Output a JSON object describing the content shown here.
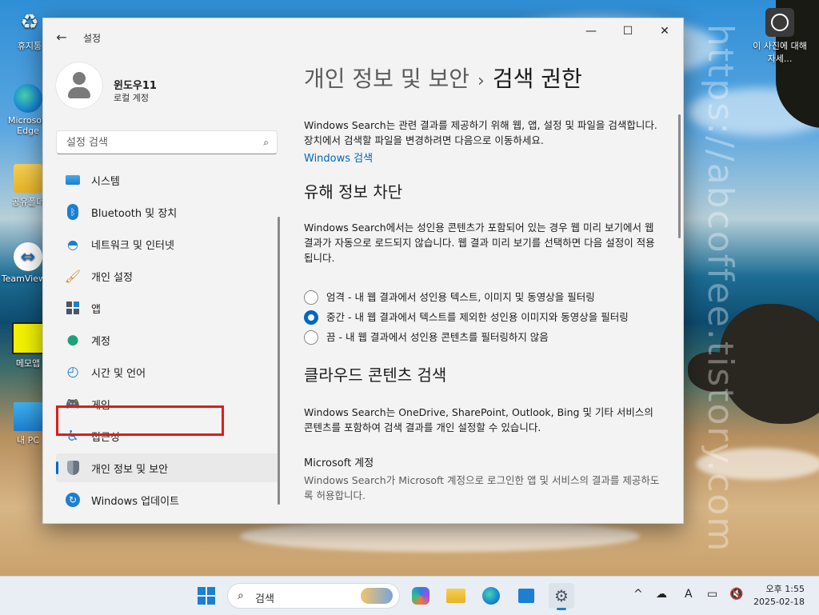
{
  "desktop": {
    "icons": [
      {
        "label": "휴지통",
        "icon": "recycle-bin-icon"
      },
      {
        "label": "Microsoft Edge",
        "icon": "edge-icon"
      },
      {
        "label": "공유폴더",
        "icon": "folder-icon"
      },
      {
        "label": "TeamViewer",
        "icon": "teamviewer-icon"
      },
      {
        "label": "메모앱",
        "icon": "memo-icon"
      },
      {
        "label": "내 PC",
        "icon": "pc-icon"
      }
    ],
    "right_icon_label": "이 사진에 대해 자세...",
    "watermark": "https://abcoffee.tistory.com"
  },
  "window": {
    "title": "설정",
    "controls": {
      "minimize": "—",
      "maximize": "☐",
      "close": "✕"
    },
    "profile": {
      "name": "윈도우11",
      "account_type": "로컬 계정"
    },
    "search": {
      "placeholder": "설정 검색"
    },
    "nav": [
      {
        "label": "시스템",
        "icon": "system-icon"
      },
      {
        "label": "Bluetooth 및 장치",
        "icon": "bluetooth-icon"
      },
      {
        "label": "네트워크 및 인터넷",
        "icon": "network-icon"
      },
      {
        "label": "개인 설정",
        "icon": "brush-icon"
      },
      {
        "label": "앱",
        "icon": "apps-icon"
      },
      {
        "label": "계정",
        "icon": "account-icon"
      },
      {
        "label": "시간 및 언어",
        "icon": "clock-globe-icon"
      },
      {
        "label": "게임",
        "icon": "gamepad-icon"
      },
      {
        "label": "접근성",
        "icon": "accessibility-icon"
      },
      {
        "label": "개인 정보 및 보안",
        "icon": "shield-icon"
      },
      {
        "label": "Windows 업데이트",
        "icon": "update-icon"
      }
    ],
    "active_nav": "개인 정보 및 보안",
    "highlighted_nav": "개인 설정",
    "highlight_color": "#e01b1b",
    "accent_color": "#0067c0"
  },
  "content": {
    "breadcrumb_parent": "개인 정보 및 보안",
    "breadcrumb_sep": "›",
    "breadcrumb_current": "검색 권한",
    "intro": "Windows Search는 관련 결과를 제공하기 위해 웹, 앱, 설정 및 파일을 검색합니다. 장치에서 검색할 파일을 변경하려면 다음으로 이동하세요.",
    "intro_link": "Windows 검색",
    "safesearch": {
      "heading": "유해 정보 차단",
      "desc": "Windows Search에서는 성인용 콘텐츠가 포함되어 있는 경우 웹 미리 보기에서 웹 결과가 자동으로 로드되지 않습니다. 웹 결과 미리 보기를 선택하면 다음 설정이 적용됩니다.",
      "options": [
        {
          "label": "엄격 - 내 웹 결과에서 성인용 텍스트, 이미지 및 동영상을 필터링",
          "selected": false
        },
        {
          "label": "중간 - 내 웹 결과에서 텍스트를 제외한 성인용 이미지와 동영상을 필터링",
          "selected": true
        },
        {
          "label": "끔 - 내 웹 결과에서 성인용 콘텐츠를 필터링하지 않음",
          "selected": false
        }
      ]
    },
    "cloud": {
      "heading": "클라우드 콘텐츠 검색",
      "desc": "Windows Search는 OneDrive, SharePoint, Outlook, Bing 및 기타 서비스의 콘텐츠를 포함하여 검색 결과를 개인 설정할 수 있습니다.",
      "ms_account_title": "Microsoft 계정",
      "ms_account_desc": "Windows Search가 Microsoft 계정으로 로그인한 앱 및 서비스의 결과를 제공하도록 허용합니다."
    }
  },
  "taskbar": {
    "search_placeholder": "검색",
    "apps": [
      "start-icon",
      "copilot-icon",
      "file-explorer-icon",
      "edge-icon",
      "store-icon",
      "settings-icon"
    ],
    "tray": {
      "chevron": "^",
      "input_indicator": "A"
    },
    "time": "오후 1:55",
    "date": "2025-02-18"
  }
}
